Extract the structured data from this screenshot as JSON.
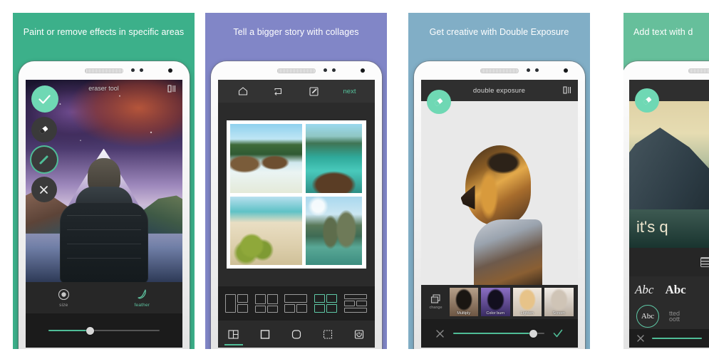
{
  "gallery": {
    "panels": [
      {
        "id": "panel-eraser",
        "caption": "Paint or remove effects in specific areas",
        "bg": "#3cb08a",
        "app_title": "eraser tool",
        "tools": [
          {
            "name": "confirm-icon",
            "label": "confirm"
          },
          {
            "name": "eraser-icon",
            "label": "eraser"
          },
          {
            "name": "brush-icon",
            "label": "brush"
          },
          {
            "name": "close-icon",
            "label": "cancel"
          }
        ],
        "controls": [
          {
            "label": "size",
            "icon": "size-icon",
            "active": false
          },
          {
            "label": "feather",
            "icon": "feather-icon",
            "active": true
          }
        ],
        "slider": {
          "value": 38,
          "name": "size-slider"
        },
        "compare_icon": "compare-icon"
      },
      {
        "id": "panel-collage",
        "caption": "Tell a bigger story with collages",
        "bg": "#8186c7",
        "toolbar": [
          {
            "name": "home-icon",
            "label": "home"
          },
          {
            "name": "shuffle-icon",
            "label": "shuffle"
          },
          {
            "name": "edit-icon",
            "label": "edit"
          }
        ],
        "next_label": "next",
        "photos": [
          {
            "name": "collage-photo-boats-beach",
            "selected": true
          },
          {
            "name": "collage-photo-boat-bow",
            "selected": false
          },
          {
            "name": "collage-photo-coconuts",
            "selected": false
          },
          {
            "name": "collage-photo-karst-cliffs",
            "selected": false
          }
        ],
        "templates": [
          {
            "name": "layout-template-1",
            "selected": false
          },
          {
            "name": "layout-template-2",
            "selected": false
          },
          {
            "name": "layout-template-3",
            "selected": false
          },
          {
            "name": "layout-template-4",
            "selected": true
          },
          {
            "name": "layout-template-5",
            "selected": false
          }
        ],
        "tabs": [
          {
            "name": "tab-layout",
            "active": true
          },
          {
            "name": "tab-border",
            "active": false
          },
          {
            "name": "tab-corner",
            "active": false
          },
          {
            "name": "tab-spacing",
            "active": false
          },
          {
            "name": "tab-ratio",
            "active": false
          }
        ]
      },
      {
        "id": "panel-double-exposure",
        "caption": "Get creative with Double Exposure",
        "bg": "#81aec6",
        "app_title": "double exposure",
        "compare_icon": "compare-icon",
        "fab_icon": "eraser-icon",
        "change_label": "change",
        "blend_modes": [
          {
            "label": "Multiply",
            "selected": false
          },
          {
            "label": "Color burn",
            "selected": false
          },
          {
            "label": "Lighten",
            "selected": true
          },
          {
            "label": "Screen",
            "selected": false
          }
        ],
        "slider": {
          "value": 88,
          "name": "opacity-slider"
        },
        "cancel_icon": "close-icon",
        "confirm_icon": "check-icon"
      },
      {
        "id": "panel-text",
        "caption": "Add text with d",
        "bg": "#66bf9b",
        "fab_icon": "eraser-icon",
        "overlay_text": "it's q",
        "keyboard_icon": "keyboard-icon",
        "font_samples": [
          "Abc",
          "Abc",
          "Abc"
        ],
        "font_stack_label": "tted\noott",
        "slider": {
          "value": 70,
          "name": "text-slider"
        },
        "cancel_icon": "close-icon"
      }
    ]
  }
}
